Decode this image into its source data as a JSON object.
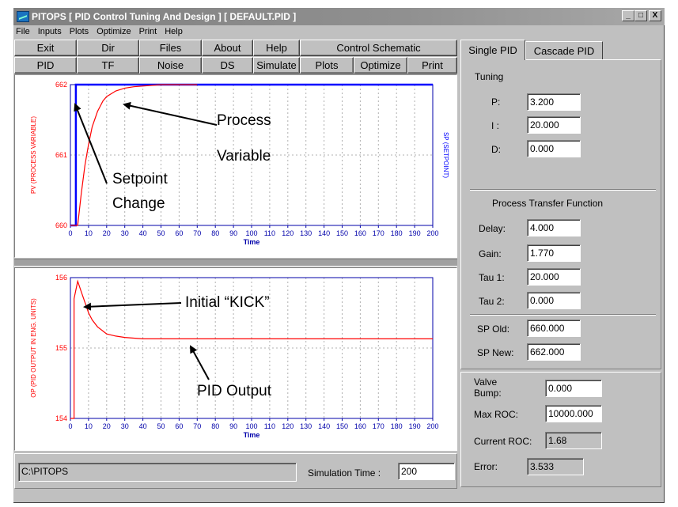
{
  "window": {
    "title": "PITOPS [ PID Control Tuning And Design ]   [ DEFAULT.PID ]"
  },
  "title_buttons": [
    "_",
    "□",
    "X"
  ],
  "menu": [
    "File",
    "Inputs",
    "Plots",
    "Optimize",
    "Print",
    "Help"
  ],
  "toolbar_row1": [
    "Exit",
    "Dir",
    "Files",
    "About",
    "Help",
    "Control Schematic"
  ],
  "toolbar_row2": [
    "PID",
    "TF",
    "Noise",
    "DS",
    "Simulate",
    "Plots",
    "Optimize",
    "Print"
  ],
  "tabs": [
    "Single PID",
    "Cascade PID"
  ],
  "tuning": {
    "heading": "Tuning",
    "p_label": "P:",
    "p_value": "3.200",
    "i_label": "I :",
    "i_value": "20.000",
    "d_label": "D:",
    "d_value": "0.000"
  },
  "process_tf": {
    "heading": "Process Transfer Function",
    "delay_label": "Delay:",
    "delay_value": "4.000",
    "gain_label": "Gain:",
    "gain_value": "1.770",
    "tau1_label": "Tau 1:",
    "tau1_value": "20.000",
    "tau2_label": "Tau 2:",
    "tau2_value": "0.000"
  },
  "setpoint": {
    "sp_old_label": "SP Old:",
    "sp_old_value": "660.000",
    "sp_new_label": "SP New:",
    "sp_new_value": "662.000"
  },
  "valve": {
    "bump_label_1": "Valve",
    "bump_label_2": "Bump:",
    "bump_value": "0.000",
    "max_roc_label": "Max ROC:",
    "max_roc_value": "10000.000",
    "current_roc_label": "Current ROC:",
    "current_roc_value": "1.68",
    "error_label": "Error:",
    "error_value": "3.533"
  },
  "status": {
    "path": "C:\\PITOPS",
    "sim_time_label": "Simulation Time :",
    "sim_time_value": "200"
  },
  "annotations": {
    "process_variable_1": "Process",
    "process_variable_2": "Variable",
    "setpoint_change_1": "Setpoint",
    "setpoint_change_2": "Change",
    "initial_kick": "Initial “KICK”",
    "pid_output": "PID Output"
  },
  "chart_data": [
    {
      "type": "line",
      "xlabel": "Time",
      "ylabel": "PV (PROCESS VARIABLE)",
      "ylabel_right": "SP (SETPOINT)",
      "xlim": [
        0,
        200
      ],
      "ylim": [
        660,
        662
      ],
      "x_ticks": [
        0,
        10,
        20,
        30,
        40,
        50,
        60,
        70,
        80,
        90,
        100,
        110,
        120,
        130,
        140,
        150,
        160,
        170,
        180,
        190,
        200
      ],
      "y_ticks": [
        660,
        661,
        662
      ],
      "grid": true,
      "series": [
        {
          "name": "SP (SETPOINT)",
          "color": "#0000ff",
          "x": [
            0,
            3,
            3,
            200
          ],
          "y": [
            660,
            660,
            662,
            662
          ]
        },
        {
          "name": "PV (PROCESS VARIABLE)",
          "color": "#ff0000",
          "x": [
            0,
            4,
            6,
            8,
            10,
            12,
            15,
            18,
            20,
            25,
            30,
            35,
            40,
            45,
            50,
            60,
            70
          ],
          "y": [
            660,
            660,
            660.45,
            660.85,
            661.15,
            661.4,
            661.62,
            661.77,
            661.83,
            661.91,
            661.95,
            661.97,
            661.98,
            661.99,
            662,
            662,
            662
          ]
        }
      ]
    },
    {
      "type": "line",
      "xlabel": "Time",
      "ylabel": "OP (PID OUTPUT IN ENG. UNITS)",
      "xlim": [
        0,
        200
      ],
      "ylim": [
        154,
        156
      ],
      "x_ticks": [
        0,
        10,
        20,
        30,
        40,
        50,
        60,
        70,
        80,
        90,
        100,
        110,
        120,
        130,
        140,
        150,
        160,
        170,
        180,
        190,
        200
      ],
      "y_ticks": [
        154,
        155,
        156
      ],
      "grid": true,
      "series": [
        {
          "name": "OP (PID OUTPUT IN ENG. UNITS)",
          "color": "#ff0000",
          "x": [
            0,
            2,
            2,
            4,
            6,
            8,
            10,
            12,
            15,
            18,
            20,
            25,
            30,
            35,
            40,
            50,
            60,
            80,
            100,
            150,
            200
          ],
          "y": [
            154,
            154,
            155.7,
            155.95,
            155.8,
            155.65,
            155.5,
            155.4,
            155.3,
            155.24,
            155.2,
            155.17,
            155.15,
            155.14,
            155.13,
            155.13,
            155.13,
            155.13,
            155.13,
            155.13,
            155.13
          ]
        }
      ]
    }
  ]
}
